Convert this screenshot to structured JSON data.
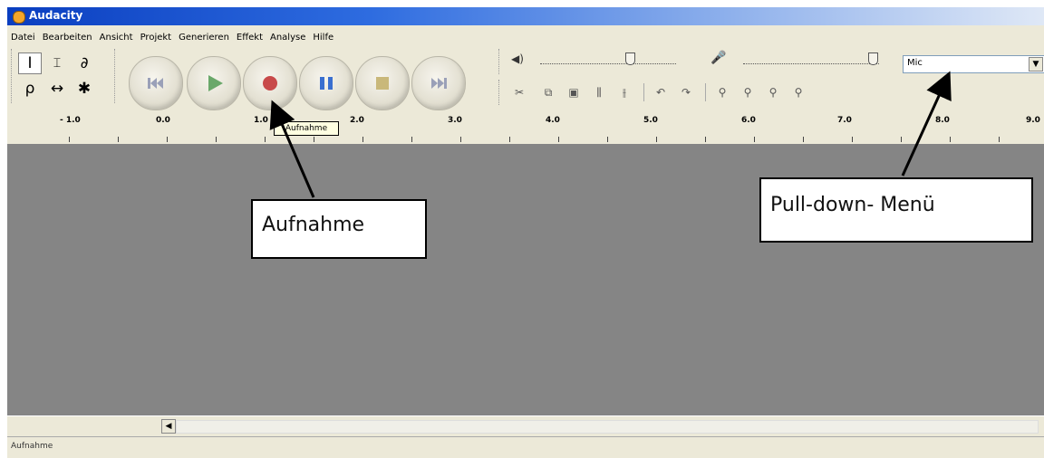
{
  "window": {
    "title": "Audacity"
  },
  "menu": [
    "Datei",
    "Bearbeiten",
    "Ansicht",
    "Projekt",
    "Generieren",
    "Effekt",
    "Analyse",
    "Hilfe"
  ],
  "tools": {
    "selection": "I",
    "envelope": "⌶",
    "draw": "∂",
    "zoom": "ρ",
    "timeshift": "↔",
    "multi": "✱"
  },
  "transport": [
    "skip-start",
    "play",
    "record",
    "pause",
    "stop",
    "skip-end"
  ],
  "colors": {
    "play": "#6aa86a",
    "record": "#c84a4a",
    "pause": "#3a6fd0",
    "stop": "#c9b87a",
    "skip": "#9aa0b8"
  },
  "input_source": "Mic",
  "ruler": [
    "- 1.0",
    "0.0",
    "1.0",
    "2.0",
    "3.0",
    "4.0",
    "5.0",
    "6.0",
    "7.0",
    "8.0",
    "9.0"
  ],
  "tooltip": "Aufnahme",
  "status": "Aufnahme",
  "callouts": {
    "record": "Aufnahme",
    "menu": "Pull-down- Menü"
  }
}
